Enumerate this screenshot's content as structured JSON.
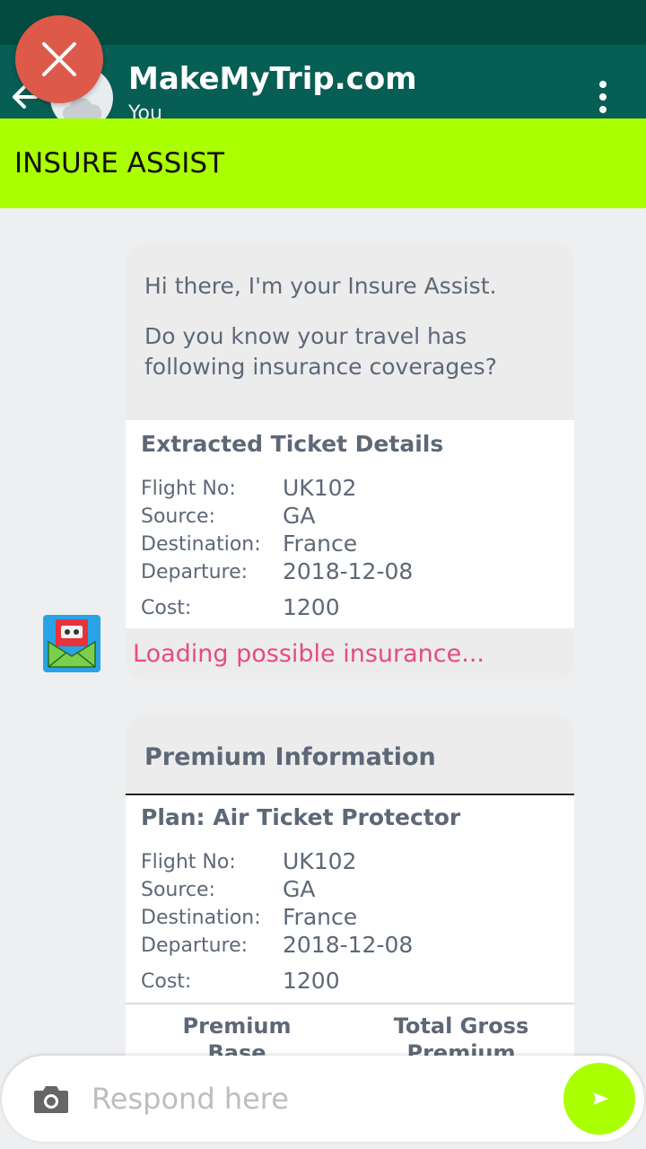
{
  "header": {
    "contact_name": "MakeMyTrip.com",
    "contact_subtitle": "You"
  },
  "banner": {
    "title": "INSURE ASSIST"
  },
  "messages": {
    "intro": {
      "greeting": "Hi there, I'm your Insure Assist.",
      "question": "Do you know your travel has following insurance coverages?",
      "details_title": "Extracted Ticket Details",
      "rows": [
        {
          "label": "Flight No:",
          "value": "UK102"
        },
        {
          "label": "Source:",
          "value": "GA"
        },
        {
          "label": "Destination:",
          "value": "France"
        },
        {
          "label": "Departure:",
          "value": "2018-12-08"
        },
        {
          "label": "Cost:",
          "value": "1200"
        }
      ],
      "status": "Loading possible insurance..."
    },
    "premium": {
      "title": "Premium Information",
      "plan": "Plan: Air Ticket Protector",
      "rows": [
        {
          "label": "Flight No:",
          "value": "UK102"
        },
        {
          "label": "Source:",
          "value": "GA"
        },
        {
          "label": "Destination:",
          "value": "France"
        },
        {
          "label": "Departure:",
          "value": "2018-12-08"
        },
        {
          "label": "Cost:",
          "value": "1200"
        }
      ],
      "columns": [
        "Premium Base",
        "Total Gross Premium"
      ]
    }
  },
  "composer": {
    "placeholder": "Respond here"
  },
  "colors": {
    "header": "#075e54",
    "status_bar": "#034b40",
    "banner": "#aaff00",
    "send_button": "#aaff00",
    "close_button": "#dd5a4a",
    "loading_text": "#e64b84",
    "card_text": "#5d6877"
  },
  "icons": {
    "close": "close-icon",
    "back": "back-arrow-icon",
    "menu": "more-vertical-icon",
    "camera": "camera-icon",
    "send": "send-icon",
    "bot": "bot-mail-icon"
  }
}
